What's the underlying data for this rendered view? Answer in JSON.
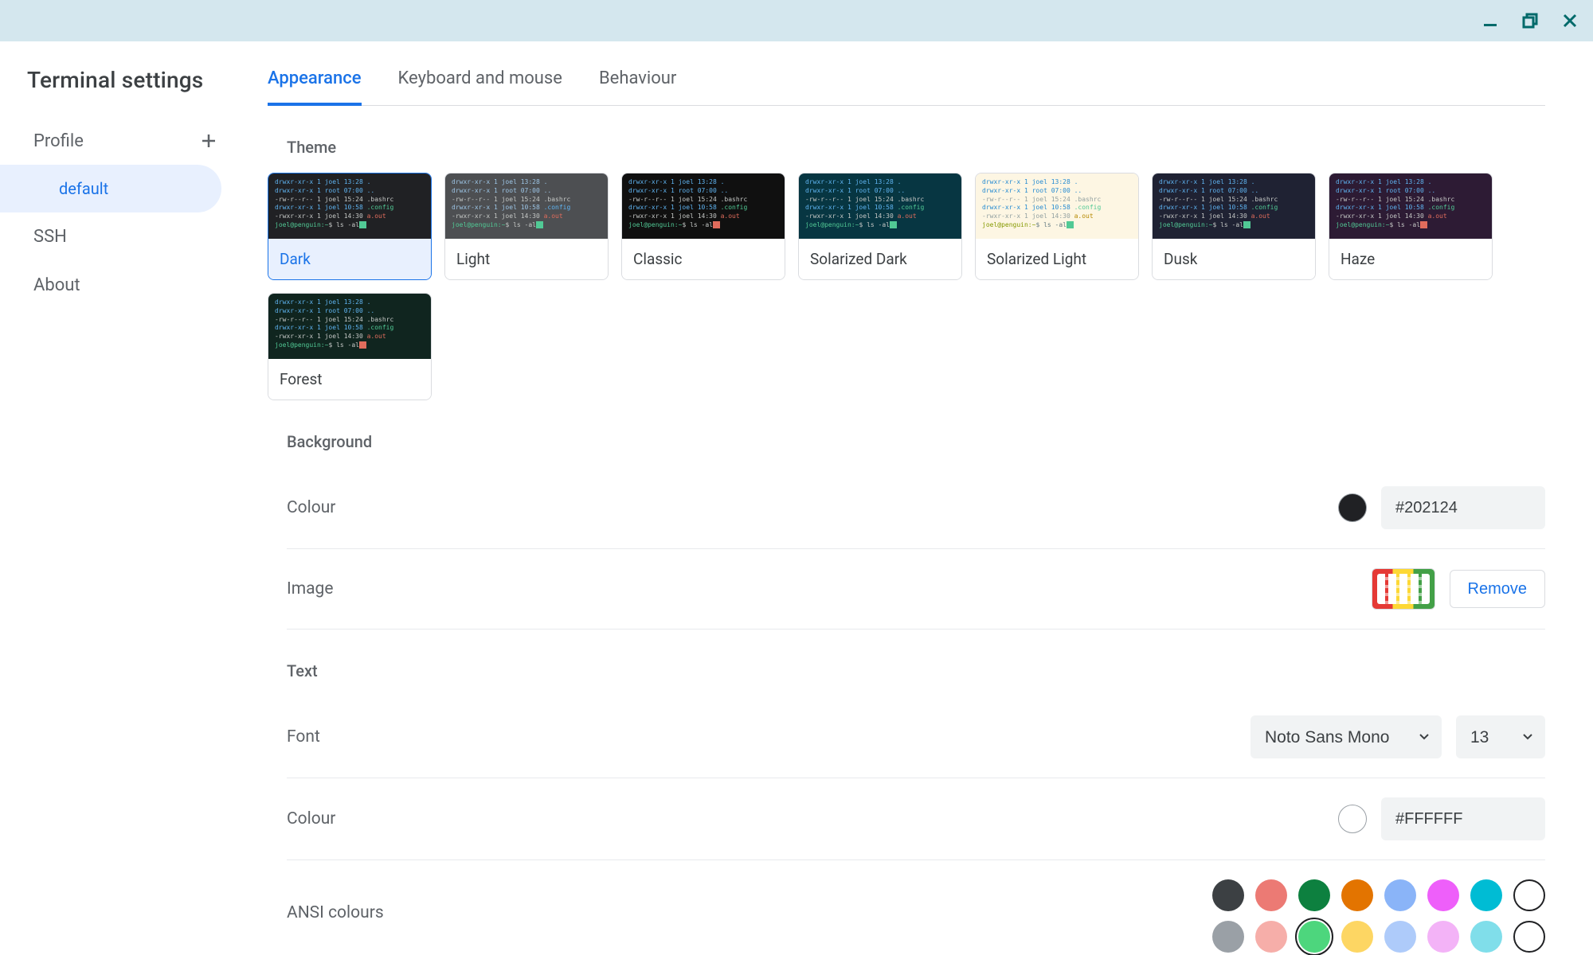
{
  "window": {
    "title": "Terminal settings"
  },
  "sidebar": {
    "title": "Terminal settings",
    "profile_header": "Profile",
    "profile_items": [
      {
        "label": "default",
        "selected": true
      }
    ],
    "links": [
      {
        "label": "SSH"
      },
      {
        "label": "About"
      }
    ]
  },
  "tabs": [
    {
      "label": "Appearance",
      "active": true
    },
    {
      "label": "Keyboard and mouse",
      "active": false
    },
    {
      "label": "Behaviour",
      "active": false
    }
  ],
  "sections": {
    "theme": {
      "heading": "Theme",
      "themes": [
        {
          "name": "Dark",
          "bg": "#202124",
          "selected": true,
          "variant": "dark"
        },
        {
          "name": "Light",
          "bg": "#4d4f52",
          "selected": false,
          "variant": "light"
        },
        {
          "name": "Classic",
          "bg": "#101010",
          "selected": false,
          "variant": "classic"
        },
        {
          "name": "Solarized Dark",
          "bg": "#073642",
          "selected": false,
          "variant": "soldark"
        },
        {
          "name": "Solarized Light",
          "bg": "#fdf6e3",
          "selected": false,
          "variant": "sollight"
        },
        {
          "name": "Dusk",
          "bg": "#1f2233",
          "selected": false,
          "variant": "dusk"
        },
        {
          "name": "Haze",
          "bg": "#2d1b34",
          "selected": false,
          "variant": "haze"
        },
        {
          "name": "Forest",
          "bg": "#10251f",
          "selected": false,
          "variant": "forest"
        }
      ],
      "preview_lines": [
        "drwxr-xr-x 1 joel 13:28 .",
        "drwxr-xr-x 1 root 07:00 ..",
        "-rw-r--r-- 1 joel 15:24 .bashrc",
        "drwxr-xr-x 1 joel 10:58 .config",
        "-rwxr-xr-x 1 joel 14:30 a.out",
        "joel@penguin:~$ ls -al"
      ]
    },
    "background": {
      "heading": "Background",
      "colour_label": "Colour",
      "colour_value": "#202124",
      "image_label": "Image",
      "remove_label": "Remove"
    },
    "text": {
      "heading": "Text",
      "font_label": "Font",
      "font_value": "Noto Sans Mono",
      "size_value": "13",
      "colour_label": "Colour",
      "colour_value": "#FFFFFF",
      "ansi_label": "ANSI colours",
      "ansi_colours_row1": [
        "#3c4043",
        "#ec7a74",
        "#0d803f",
        "#e37400",
        "#8ab4f8",
        "#ee5ffa",
        "#00bcd4",
        "#ffffff"
      ],
      "ansi_colours_row2": [
        "#9aa0a6",
        "#f6aea9",
        "#4dd67d",
        "#fdd663",
        "#aecbfa",
        "#f3b3f7",
        "#80deea",
        "#f8f9fa"
      ]
    }
  }
}
